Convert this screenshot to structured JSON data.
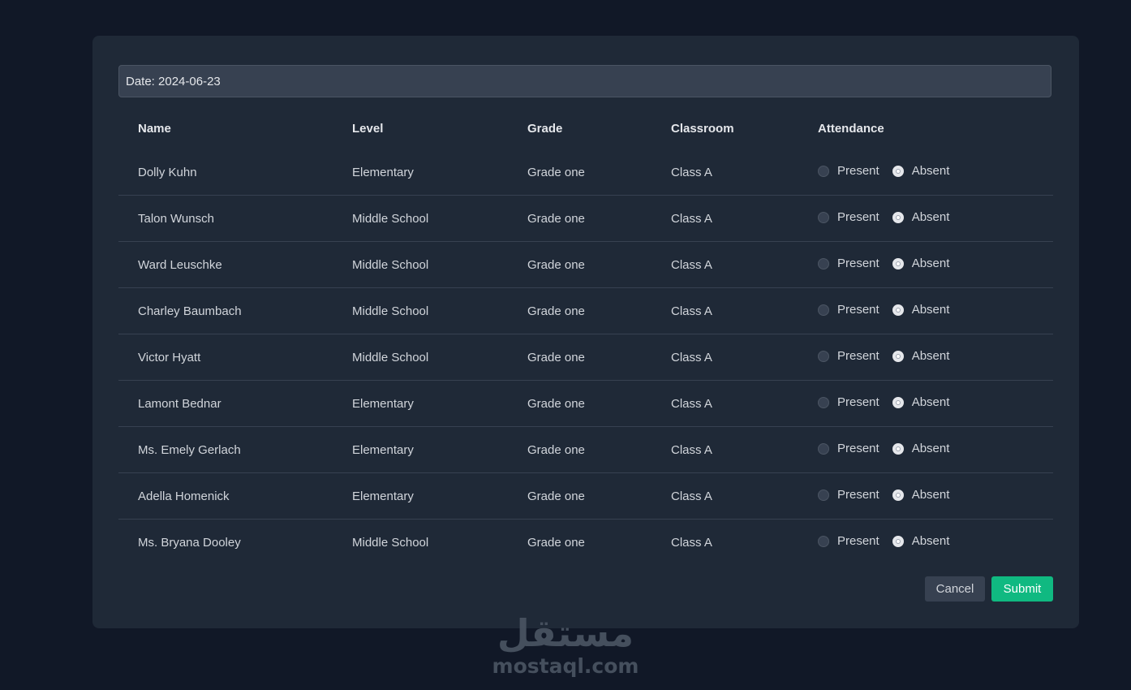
{
  "form": {
    "date_value": "Date: 2024-06-23"
  },
  "table": {
    "headers": {
      "name": "Name",
      "level": "Level",
      "grade": "Grade",
      "classroom": "Classroom",
      "attendance": "Attendance"
    },
    "present_label": "Present",
    "absent_label": "Absent",
    "rows": [
      {
        "name": "Dolly Kuhn",
        "level": "Elementary",
        "grade": "Grade one",
        "classroom": "Class A",
        "attendance": "Absent"
      },
      {
        "name": "Talon Wunsch",
        "level": "Middle School",
        "grade": "Grade one",
        "classroom": "Class A",
        "attendance": "Absent"
      },
      {
        "name": "Ward Leuschke",
        "level": "Middle School",
        "grade": "Grade one",
        "classroom": "Class A",
        "attendance": "Absent"
      },
      {
        "name": "Charley Baumbach",
        "level": "Middle School",
        "grade": "Grade one",
        "classroom": "Class A",
        "attendance": "Absent"
      },
      {
        "name": "Victor Hyatt",
        "level": "Middle School",
        "grade": "Grade one",
        "classroom": "Class A",
        "attendance": "Absent"
      },
      {
        "name": "Lamont Bednar",
        "level": "Elementary",
        "grade": "Grade one",
        "classroom": "Class A",
        "attendance": "Absent"
      },
      {
        "name": "Ms. Emely Gerlach",
        "level": "Elementary",
        "grade": "Grade one",
        "classroom": "Class A",
        "attendance": "Absent"
      },
      {
        "name": "Adella Homenick",
        "level": "Elementary",
        "grade": "Grade one",
        "classroom": "Class A",
        "attendance": "Absent"
      },
      {
        "name": "Ms. Bryana Dooley",
        "level": "Middle School",
        "grade": "Grade one",
        "classroom": "Class A",
        "attendance": "Absent"
      }
    ]
  },
  "actions": {
    "cancel_label": "Cancel",
    "submit_label": "Submit"
  },
  "watermark": {
    "arabic": "مستقل",
    "latin": "mostaql.com"
  },
  "colors": {
    "page_bg": "#111827",
    "card_bg": "#1f2937",
    "submit_bg": "#10b981"
  }
}
